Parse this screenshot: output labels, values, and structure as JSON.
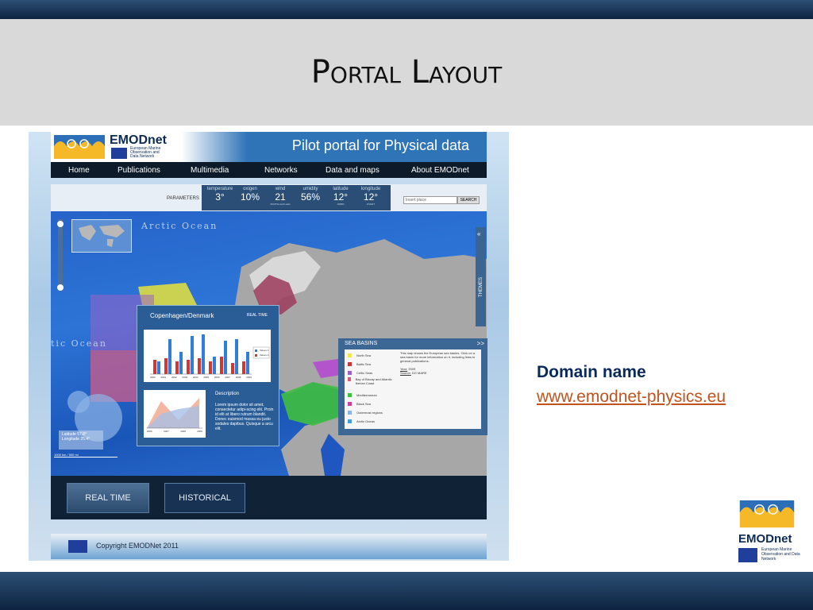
{
  "slide": {
    "title": "Portal Layout",
    "domain_heading": "Domain name",
    "domain_link": "www.emodnet-physics.eu",
    "corner_brand": "EMODnet",
    "corner_sub": "European Marine Observation and Data Network"
  },
  "portal": {
    "brand": "EMODnet",
    "brand_sub": "European Marine Observation and Data Network",
    "header_title": "Pilot portal for Physical data",
    "nav": [
      "Home",
      "Publications",
      "Multimedia",
      "Networks",
      "Data and maps",
      "About EMODnet"
    ],
    "params_label": "PARAMETERS",
    "params": [
      {
        "name": "temperature",
        "value": "3°",
        "sub": ""
      },
      {
        "name": "oxigen",
        "value": "10%",
        "sub": ""
      },
      {
        "name": "wind",
        "value": "21",
        "sub": "SOUTH-north-east"
      },
      {
        "name": "umidity",
        "value": "56%",
        "sub": ""
      },
      {
        "name": "latitude",
        "value": "12°",
        "sub": "NORD"
      },
      {
        "name": "longitude",
        "value": "12°",
        "sub": "OVEST"
      }
    ],
    "search_placeholder": "Insert place",
    "search_button": "SEARCH",
    "map_labels": {
      "arctic": "Arctic Ocean",
      "atlantic": "tic Ocean",
      "latitude": "Latitude",
      "longitude": "Longitude",
      "lat_val": "57.8°",
      "lon_val": "25.4°",
      "scale1": "1000 km",
      "scale2": "500 mi"
    },
    "themes_label": "THEMES",
    "popup": {
      "title": "Copenhagen/Denmark",
      "mode": "REAL TIME",
      "bar_years": [
        "2000",
        "2001",
        "2002",
        "2003",
        "2004",
        "2005",
        "2006",
        "2007",
        "2008",
        "2009"
      ],
      "legend": [
        "Values 1",
        "Values 2"
      ],
      "area_years": [
        "2006",
        "2007",
        "2008",
        "2009"
      ],
      "desc_title": "Description",
      "desc": "Lorem ipsum dolor sit amet, consectetur adipi-scing elit. Proin id elit at libero rutrum blandit. Donec euismod massa eu justo sodales dapibus. Quisque a arcu elit."
    },
    "sea_basins": {
      "title": "SEA BASINS",
      "more": ">>",
      "items": [
        {
          "label": "North Sea",
          "color": "#f2e64a"
        },
        {
          "label": "Baltic Sea",
          "color": "#c8373b"
        },
        {
          "label": "Celtic Seas",
          "color": "#9b63c9"
        },
        {
          "label": "Bay of Biscay and Atlantic Iberian Coast",
          "color": "#d85b73"
        },
        {
          "label": "Mediterranean",
          "color": "#3fbf3f"
        },
        {
          "label": "Black Sea",
          "color": "#cc3fa0"
        },
        {
          "label": "Outermost regions",
          "color": "#8db4e6"
        },
        {
          "label": "Arctic Ocean",
          "color": "#3f9fe0"
        }
      ],
      "text": "This map shows the European sea basins. Click on a sea basin for more information on it, including links to general publications.",
      "year_label": "Year:",
      "year": "2009",
      "source_label": "Source:",
      "source": "DG MARE"
    },
    "buttons": {
      "realtime": "REAL TIME",
      "historical": "HISTORICAL"
    },
    "copyright": "Copyright EMODNet 2011"
  }
}
